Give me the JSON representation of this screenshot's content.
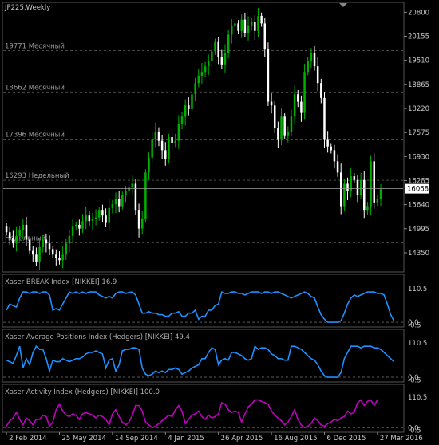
{
  "chart_data": [
    {
      "type": "candlestick",
      "title": "JP225,Weekly",
      "ylim": [
        13900,
        21000
      ],
      "y_ticks": [
        "20800",
        "20155",
        "19510",
        "18865",
        "18220",
        "17575",
        "16930",
        "16285",
        "15640",
        "14995",
        "14350"
      ],
      "current_price_label": "16068",
      "levels": [
        {
          "price": "19771",
          "label": "Месячный"
        },
        {
          "price": "18662",
          "label": "Месячный"
        },
        {
          "price": "17396",
          "label": "Месячный"
        },
        {
          "price": "16293",
          "label": "Недельный"
        },
        {
          "price": "",
          "label": "Недельный"
        }
      ],
      "x_labels": [
        "2 Feb 2014",
        "25 May 2014",
        "14 Sep 2014",
        "4 Jan 2015",
        "26 Apr 2015",
        "16 Aug 2015",
        "6 Dec 2015",
        "27 Mar 2016"
      ],
      "x_label_weeks": [
        0,
        16,
        32,
        48,
        64,
        80,
        96,
        112
      ],
      "close": [
        14900,
        14750,
        14600,
        14800,
        14950,
        15100,
        14700,
        14400,
        14300,
        14100,
        14500,
        14700,
        14600,
        14450,
        14300,
        14200,
        14150,
        14300,
        14600,
        14800,
        15050,
        15100,
        15000,
        15200,
        15350,
        15200,
        15250,
        15300,
        15500,
        15350,
        15150,
        15550,
        15650,
        15800,
        15600,
        15900,
        16000,
        16100,
        16200,
        15500,
        15000,
        15250,
        16500,
        16900,
        17400,
        17600,
        17350,
        17100,
        16850,
        17450,
        17300,
        17350,
        17800,
        18000,
        18300,
        18200,
        18600,
        18900,
        19100,
        19200,
        19350,
        19500,
        19750,
        20000,
        19600,
        19400,
        19700,
        20200,
        20450,
        20500,
        20300,
        20600,
        20250,
        20450,
        20550,
        20300,
        20700,
        20500,
        19800,
        18400,
        18300,
        17700,
        17400,
        18000,
        17500,
        17600,
        18000,
        18600,
        18400,
        18100,
        19200,
        19500,
        19700,
        19350,
        18900,
        18500,
        17400,
        17200,
        17100,
        16800,
        16500,
        15600,
        16200,
        16000,
        16400,
        16300,
        15900,
        16300,
        15500,
        15600,
        16800,
        15700,
        15800,
        16050
      ],
      "x_span": [
        0,
        120
      ]
    },
    {
      "type": "line",
      "title": "Xaser BREAK Index [NIKKEI] 16.9",
      "color": "#1e90ff",
      "y_ticks": [
        "110.5",
        "0.0",
        "-0.5"
      ],
      "ylim": [
        -5,
        116
      ],
      "values": [
        40,
        60,
        55,
        50,
        80,
        100,
        100,
        95,
        100,
        100,
        95,
        100,
        100,
        90,
        40,
        45,
        40,
        60,
        80,
        100,
        95,
        100,
        95,
        100,
        95,
        100,
        100,
        100,
        90,
        85,
        80,
        85,
        80,
        95,
        100,
        100,
        95,
        98,
        100,
        90,
        60,
        30,
        30,
        35,
        30,
        30,
        25,
        25,
        20,
        20,
        30,
        30,
        35,
        20,
        20,
        30,
        30,
        40,
        10,
        20,
        20,
        40,
        40,
        55,
        60,
        100,
        95,
        95,
        100,
        100,
        95,
        95,
        90,
        95,
        100,
        100,
        100,
        95,
        100,
        100,
        95,
        100,
        100,
        95,
        90,
        85,
        80,
        85,
        90,
        95,
        100,
        95,
        85,
        80,
        50,
        25,
        10,
        0,
        0,
        0,
        0,
        5,
        30,
        60,
        80,
        90,
        85,
        90,
        95,
        100,
        100,
        100,
        95,
        95,
        90,
        60,
        25,
        5
      ],
      "x_span": [
        0,
        120
      ]
    },
    {
      "type": "line",
      "title": "Xaser Average Positions Index (Hedgers) [NIKKEI] 49.4",
      "color": "#1e90ff",
      "y_ticks": [
        "110.5",
        "0.0",
        "-0.5"
      ],
      "ylim": [
        -5,
        116
      ],
      "values": [
        55,
        50,
        45,
        70,
        100,
        30,
        60,
        40,
        80,
        100,
        90,
        90,
        60,
        20,
        55,
        50,
        50,
        60,
        55,
        50,
        55,
        60,
        60,
        65,
        75,
        80,
        80,
        85,
        80,
        75,
        30,
        55,
        60,
        20,
        40,
        85,
        90,
        90,
        95,
        95,
        90,
        30,
        10,
        5,
        10,
        20,
        15,
        20,
        15,
        25,
        25,
        30,
        25,
        10,
        15,
        20,
        30,
        35,
        40,
        60,
        60,
        80,
        95,
        90,
        40,
        55,
        60,
        55,
        80,
        80,
        75,
        70,
        60,
        55,
        60,
        100,
        90,
        95,
        95,
        90,
        75,
        70,
        60,
        60,
        55,
        55,
        100,
        100,
        95,
        90,
        80,
        70,
        60,
        55,
        40,
        20,
        5,
        0,
        0,
        0,
        0,
        15,
        60,
        80,
        100,
        100,
        100,
        95,
        100,
        100,
        100,
        95,
        95,
        90,
        80,
        70,
        60,
        50
      ],
      "x_span": [
        0,
        120
      ]
    },
    {
      "type": "line",
      "title": "Xaser Activity Index (Hedgers) [NIKKEI] 100.0",
      "color": "#c000c0",
      "y_ticks": [
        "110.5",
        "0.0",
        "-0.5"
      ],
      "ylim": [
        -5,
        116
      ],
      "values": [
        5,
        25,
        35,
        55,
        30,
        10,
        35,
        25,
        10,
        30,
        30,
        45,
        40,
        5,
        20,
        65,
        85,
        60,
        45,
        40,
        50,
        45,
        30,
        50,
        55,
        50,
        45,
        35,
        45,
        40,
        30,
        10,
        50,
        65,
        40,
        20,
        10,
        20,
        45,
        80,
        80,
        60,
        20,
        10,
        0,
        5,
        15,
        25,
        35,
        45,
        40,
        65,
        80,
        60,
        15,
        30,
        45,
        50,
        60,
        40,
        30,
        45,
        35,
        40,
        50,
        90,
        85,
        65,
        55,
        60,
        55,
        20,
        50,
        75,
        85,
        100,
        100,
        95,
        90,
        85,
        60,
        45,
        35,
        25,
        10,
        20,
        40,
        65,
        30,
        10,
        0,
        5,
        15,
        35,
        25,
        10,
        5,
        15,
        20,
        30,
        25,
        35,
        40,
        60,
        50,
        55,
        90,
        100,
        80,
        95,
        100,
        80,
        100
      ],
      "x_span": [
        0,
        120
      ]
    }
  ],
  "colors": {
    "background": "#000000",
    "bull_candle": "#00b000",
    "bear_candle": "#ffffff",
    "grid": "#4a4a4a",
    "text": "#c8c8c8"
  }
}
